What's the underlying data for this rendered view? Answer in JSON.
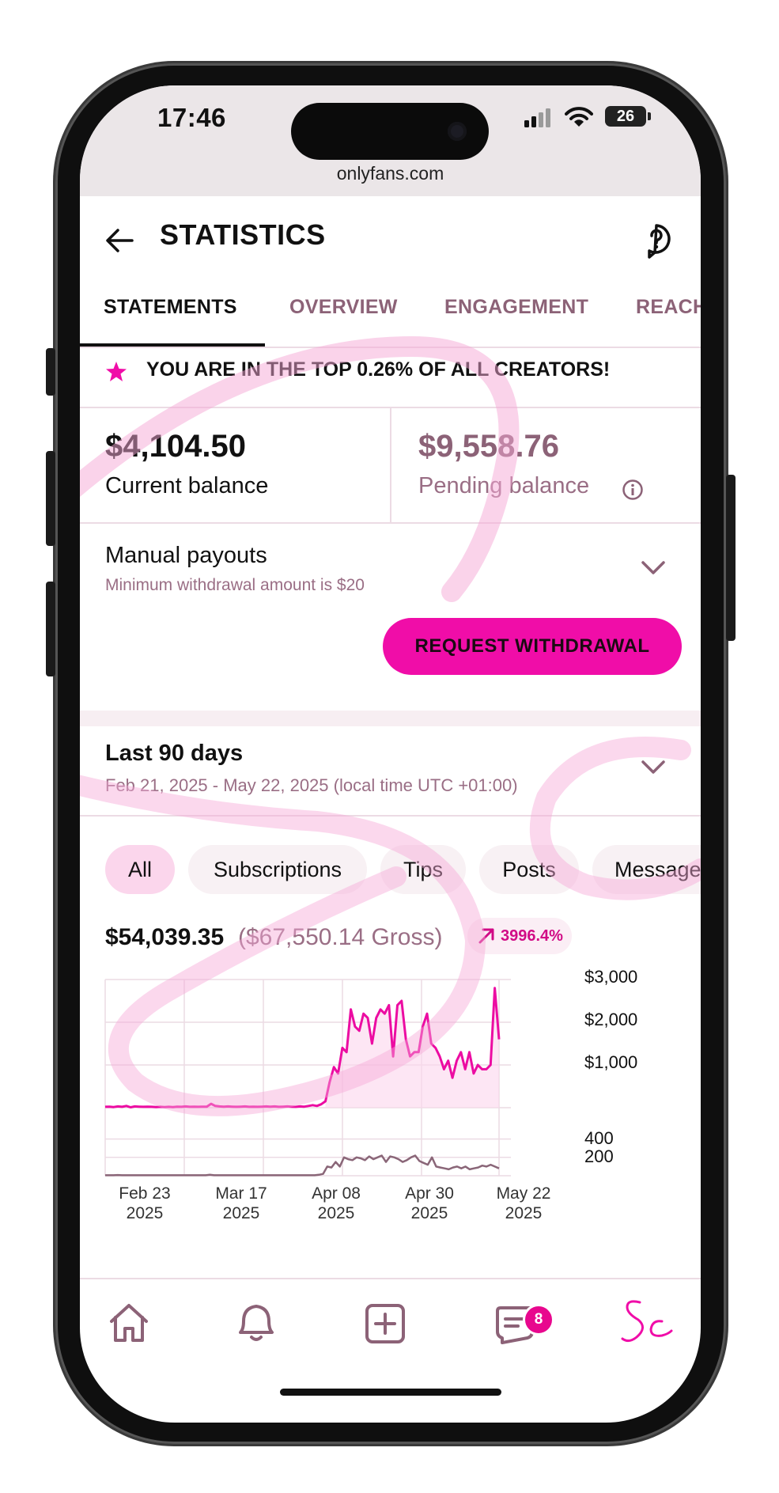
{
  "status_bar": {
    "time": "17:46",
    "battery": "26",
    "url": "onlyfans.com"
  },
  "header": {
    "title": "STATISTICS",
    "back_icon": "arrow-left-icon",
    "help_icon": "question-bubble-icon"
  },
  "tabs": [
    {
      "label": "STATEMENTS",
      "active": true
    },
    {
      "label": "OVERVIEW",
      "active": false
    },
    {
      "label": "ENGAGEMENT",
      "active": false
    },
    {
      "label": "REACH",
      "active": false
    }
  ],
  "top_banner": {
    "icon": "star-icon",
    "text": "YOU ARE IN THE TOP 0.26% OF ALL CREATORS!"
  },
  "balances": {
    "current_amount": "$4,104.50",
    "current_label": "Current balance",
    "pending_amount": "$9,558.76",
    "pending_label": "Pending balance"
  },
  "payouts": {
    "title": "Manual payouts",
    "subtitle": "Minimum withdrawal amount is $20",
    "button_label": "REQUEST WITHDRAWAL"
  },
  "period": {
    "title": "Last 90 days",
    "subtitle": "Feb 21, 2025 - May 22, 2025 (local time UTC +01:00)"
  },
  "filter_chips": [
    "All",
    "Subscriptions",
    "Tips",
    "Posts",
    "Message"
  ],
  "earnings": {
    "net": "$54,039.35",
    "gross": "($67,550.14 Gross)",
    "growth": "3996.4%"
  },
  "colors": {
    "accent": "#f00da8",
    "muted_text": "#8c6277",
    "earnings_line": "#ec0ca2",
    "count_line": "#8a6678"
  },
  "chart_data": [
    {
      "type": "area",
      "title": "",
      "ylim": [
        0,
        3000
      ],
      "y_ticks": [
        "$3,000",
        "$2,000",
        "$1,000"
      ],
      "x_tick_labels": [
        "Feb 23\n2025",
        "Mar 17\n2025",
        "Apr 08\n2025",
        "Apr 30\n2025",
        "May 22\n2025"
      ],
      "series": [
        {
          "values": [
            20,
            25,
            15,
            30,
            20,
            40,
            10,
            30,
            25,
            20,
            25,
            20,
            15,
            20,
            15,
            20,
            15,
            25,
            20,
            30,
            20,
            25,
            20,
            25,
            25,
            90,
            40,
            30,
            25,
            30,
            25,
            20,
            25,
            30,
            20,
            25,
            20,
            25,
            30,
            25,
            30,
            20,
            25,
            30,
            25,
            20,
            30,
            25,
            40,
            60,
            40,
            80,
            150,
            600,
            950,
            800,
            1400,
            1300,
            2300,
            1900,
            1800,
            2200,
            2100,
            1500,
            2100,
            2300,
            2200,
            2400,
            1200,
            2400,
            2500,
            1600,
            1200,
            1300,
            1300,
            1900,
            2200,
            1500,
            1400,
            1200,
            900,
            1100,
            700,
            1100,
            1300,
            900,
            1300,
            800,
            1000,
            900,
            900,
            1000,
            2800,
            1600
          ]
        }
      ]
    },
    {
      "type": "line",
      "title": "",
      "ylim": [
        0,
        500
      ],
      "y_ticks": [
        "400",
        "200"
      ],
      "x_tick_labels": [
        "Feb 23\n2025",
        "Mar 17\n2025",
        "Apr 08\n2025",
        "Apr 30\n2025",
        "May 22\n2025"
      ],
      "series": [
        {
          "values": [
            5,
            5,
            5,
            8,
            5,
            5,
            5,
            5,
            5,
            5,
            5,
            5,
            5,
            5,
            5,
            5,
            5,
            5,
            5,
            5,
            5,
            5,
            5,
            5,
            5,
            10,
            5,
            5,
            5,
            5,
            5,
            5,
            5,
            5,
            5,
            5,
            5,
            5,
            5,
            5,
            5,
            5,
            5,
            5,
            5,
            5,
            5,
            5,
            5,
            5,
            5,
            10,
            20,
            100,
            90,
            150,
            100,
            200,
            180,
            170,
            200,
            190,
            170,
            210,
            180,
            200,
            220,
            150,
            210,
            200,
            180,
            150,
            170,
            200,
            220,
            160,
            140,
            120,
            200,
            100,
            90,
            80,
            70,
            90,
            100,
            80,
            100,
            70,
            80,
            90,
            110,
            100,
            120,
            100,
            80
          ]
        }
      ]
    }
  ]
}
